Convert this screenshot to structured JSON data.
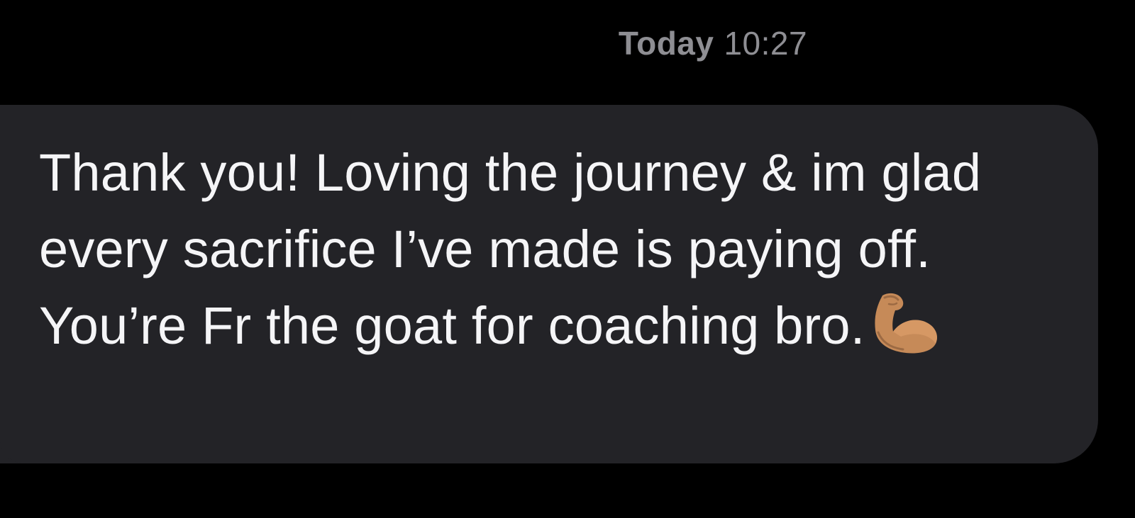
{
  "header": {
    "day_label": "Today",
    "time_label": "10:27"
  },
  "message": {
    "text": "Thank you! Loving the journey & im glad every sacrifice I’ve made is paying off. You’re Fr the goat for coaching bro.",
    "emoji": "flexed-biceps-icon",
    "bubble_color": "#232327",
    "text_color": "#f5f5f7",
    "timestamp_color": "#8e8e93"
  }
}
